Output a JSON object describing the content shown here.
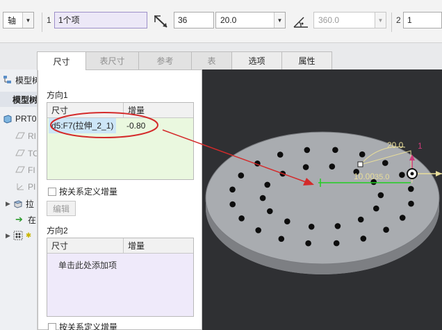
{
  "toolbar": {
    "axis_type": "轴",
    "field1_num": "1",
    "field1_value": "1个项",
    "count_value": "36",
    "spacing_value": "20.0",
    "angle_value": "360.0",
    "field2_num": "2",
    "field2_value": "1",
    "icons": [
      "pattern-count-icon",
      "angle-extent-icon"
    ]
  },
  "tree": {
    "title": "模型树",
    "header": "模型树",
    "items": [
      {
        "label": "PRT0",
        "icon": "part-icon"
      },
      {
        "label": "RI",
        "icon": "plane-icon"
      },
      {
        "label": "TO",
        "icon": "plane-icon"
      },
      {
        "label": "FI",
        "icon": "plane-icon"
      },
      {
        "label": "PI",
        "icon": "csys-icon"
      },
      {
        "label": "拉",
        "icon": "extrude-icon"
      },
      {
        "label": "在",
        "icon": "insert-here-icon"
      },
      {
        "label": "",
        "icon": "pattern-icon"
      }
    ]
  },
  "tabs": [
    {
      "label": "尺寸",
      "state": "active"
    },
    {
      "label": "表尺寸",
      "state": "disabled"
    },
    {
      "label": "参考",
      "state": "disabled"
    },
    {
      "label": "表",
      "state": "disabled"
    },
    {
      "label": "选项",
      "state": "enabled"
    },
    {
      "label": "属性",
      "state": "enabled"
    }
  ],
  "direction1": {
    "title": "方向1",
    "columns": [
      "尺寸",
      "增量"
    ],
    "rows": [
      {
        "dimension": "d5:F7(拉伸_2_1)",
        "increment": "-0.80"
      }
    ],
    "checkbox_label": "按关系定义增量",
    "edit_button": "编辑"
  },
  "direction2": {
    "title": "方向2",
    "columns": [
      "尺寸",
      "增量"
    ],
    "add_hint": "单击此处添加项",
    "checkbox_label": "按关系定义增量"
  },
  "viewport": {
    "dim_angle": "20.0",
    "dim_horizontal": "10.00",
    "dim_radius": "35.0",
    "axis_label": "1",
    "colors": {
      "background": "#2f3033",
      "disk": "#a9acb0",
      "annotation": "#e8dd9a",
      "arrow": "#d42a2a",
      "green": "#21cf21"
    }
  }
}
